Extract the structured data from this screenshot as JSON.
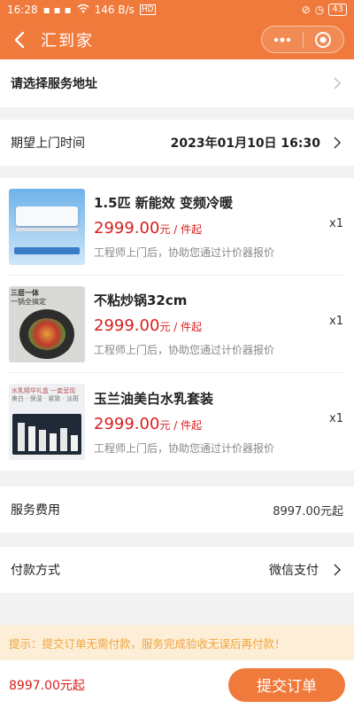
{
  "status_bar": {
    "time": "16:28",
    "network_speed": "146 B/s",
    "hd_label": "HD",
    "battery": "43"
  },
  "navbar": {
    "title": "汇到家",
    "icons": [
      "back-icon",
      "more-icon",
      "target-icon"
    ]
  },
  "address": {
    "label": "请选择服务地址"
  },
  "visit_time": {
    "label": "期望上门时间",
    "value": "2023年01月10日 16:30"
  },
  "products": [
    {
      "name": "1.5匹 新能效 变频冷暖",
      "price": "2999.00",
      "price_suffix": "元 / 件起",
      "note": "工程师上门后，协助您通过计价器报价",
      "qty": "x1"
    },
    {
      "name": "不粘炒锅32cm",
      "price": "2999.00",
      "price_suffix": "元 / 件起",
      "note": "工程师上门后，协助您通过计价器报价",
      "qty": "x1",
      "thumb_text_1": "三层一体",
      "thumb_text_2": "一锅全搞定"
    },
    {
      "name": "玉兰油美白水乳套装",
      "price": "2999.00",
      "price_suffix": "元 / 件起",
      "note": "工程师上门后，协助您通过计价器报价",
      "qty": "x1",
      "thumb_text_1": "水乳精华礼盒 一套呈现",
      "thumb_text_2": "美白 · 保湿 · 紧致 · 淡斑"
    }
  ],
  "service_fee": {
    "label": "服务费用",
    "value": "8997.00元起"
  },
  "payment": {
    "label": "付款方式",
    "value": "微信支付"
  },
  "tip": {
    "text": "提示：提交订单无需付款，服务完成验收无误后再付款！"
  },
  "bottom": {
    "total": "8997.00元起",
    "submit_label": "提交订单"
  },
  "colors": {
    "brand": "#f07a3c",
    "price": "#d81e1e",
    "tip_bg": "#fdeed8",
    "tip_text": "#f0a43b"
  }
}
